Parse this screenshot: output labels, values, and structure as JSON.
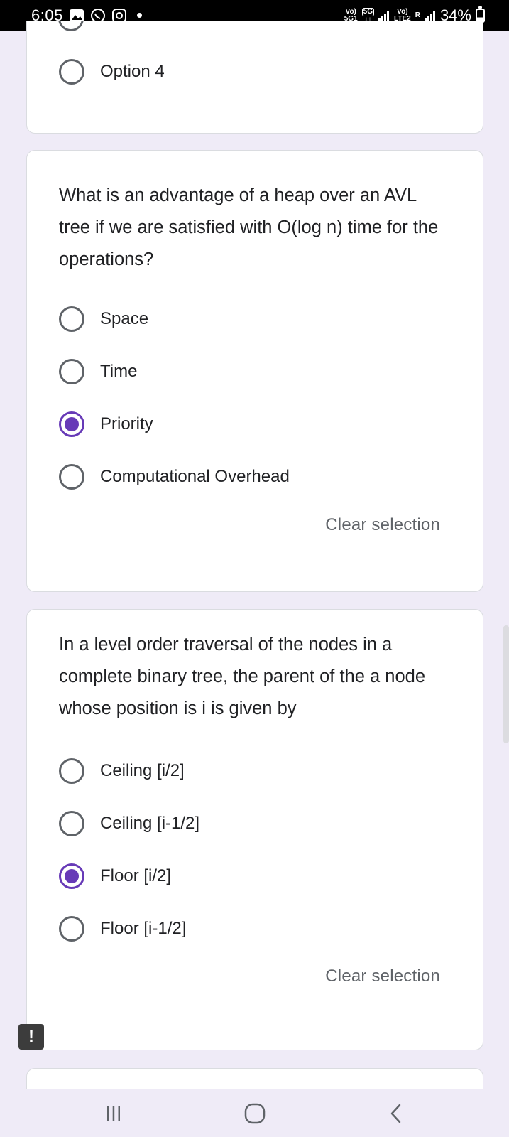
{
  "status_bar": {
    "time": "6:05",
    "network_1_top": "Vo)",
    "network_1_bottom": "5G1",
    "network_badge": "5G",
    "network_2_top": "Vo)",
    "network_2_bottom": "LTE2",
    "roaming": "R",
    "battery": "34%"
  },
  "top_card": {
    "option": "Option 4"
  },
  "question_1": {
    "text": "What is an advantage of a heap over an AVL tree if we are satisfied with O(log n) time for the operations?",
    "options": [
      "Space",
      "Time",
      "Priority",
      "Computational Overhead"
    ],
    "selected": "Priority",
    "clear_label": "Clear selection"
  },
  "question_2": {
    "text": "In a level order traversal of the nodes in a complete binary tree, the parent of the a node whose position is i is given by",
    "options": [
      "Ceiling [i/2]",
      "Ceiling [i-1/2]",
      "Floor [i/2]",
      "Floor [i-1/2]"
    ],
    "selected": "Floor [i/2]",
    "clear_label": "Clear selection"
  },
  "alert_badge": "!",
  "accent_color": "#673ab7"
}
